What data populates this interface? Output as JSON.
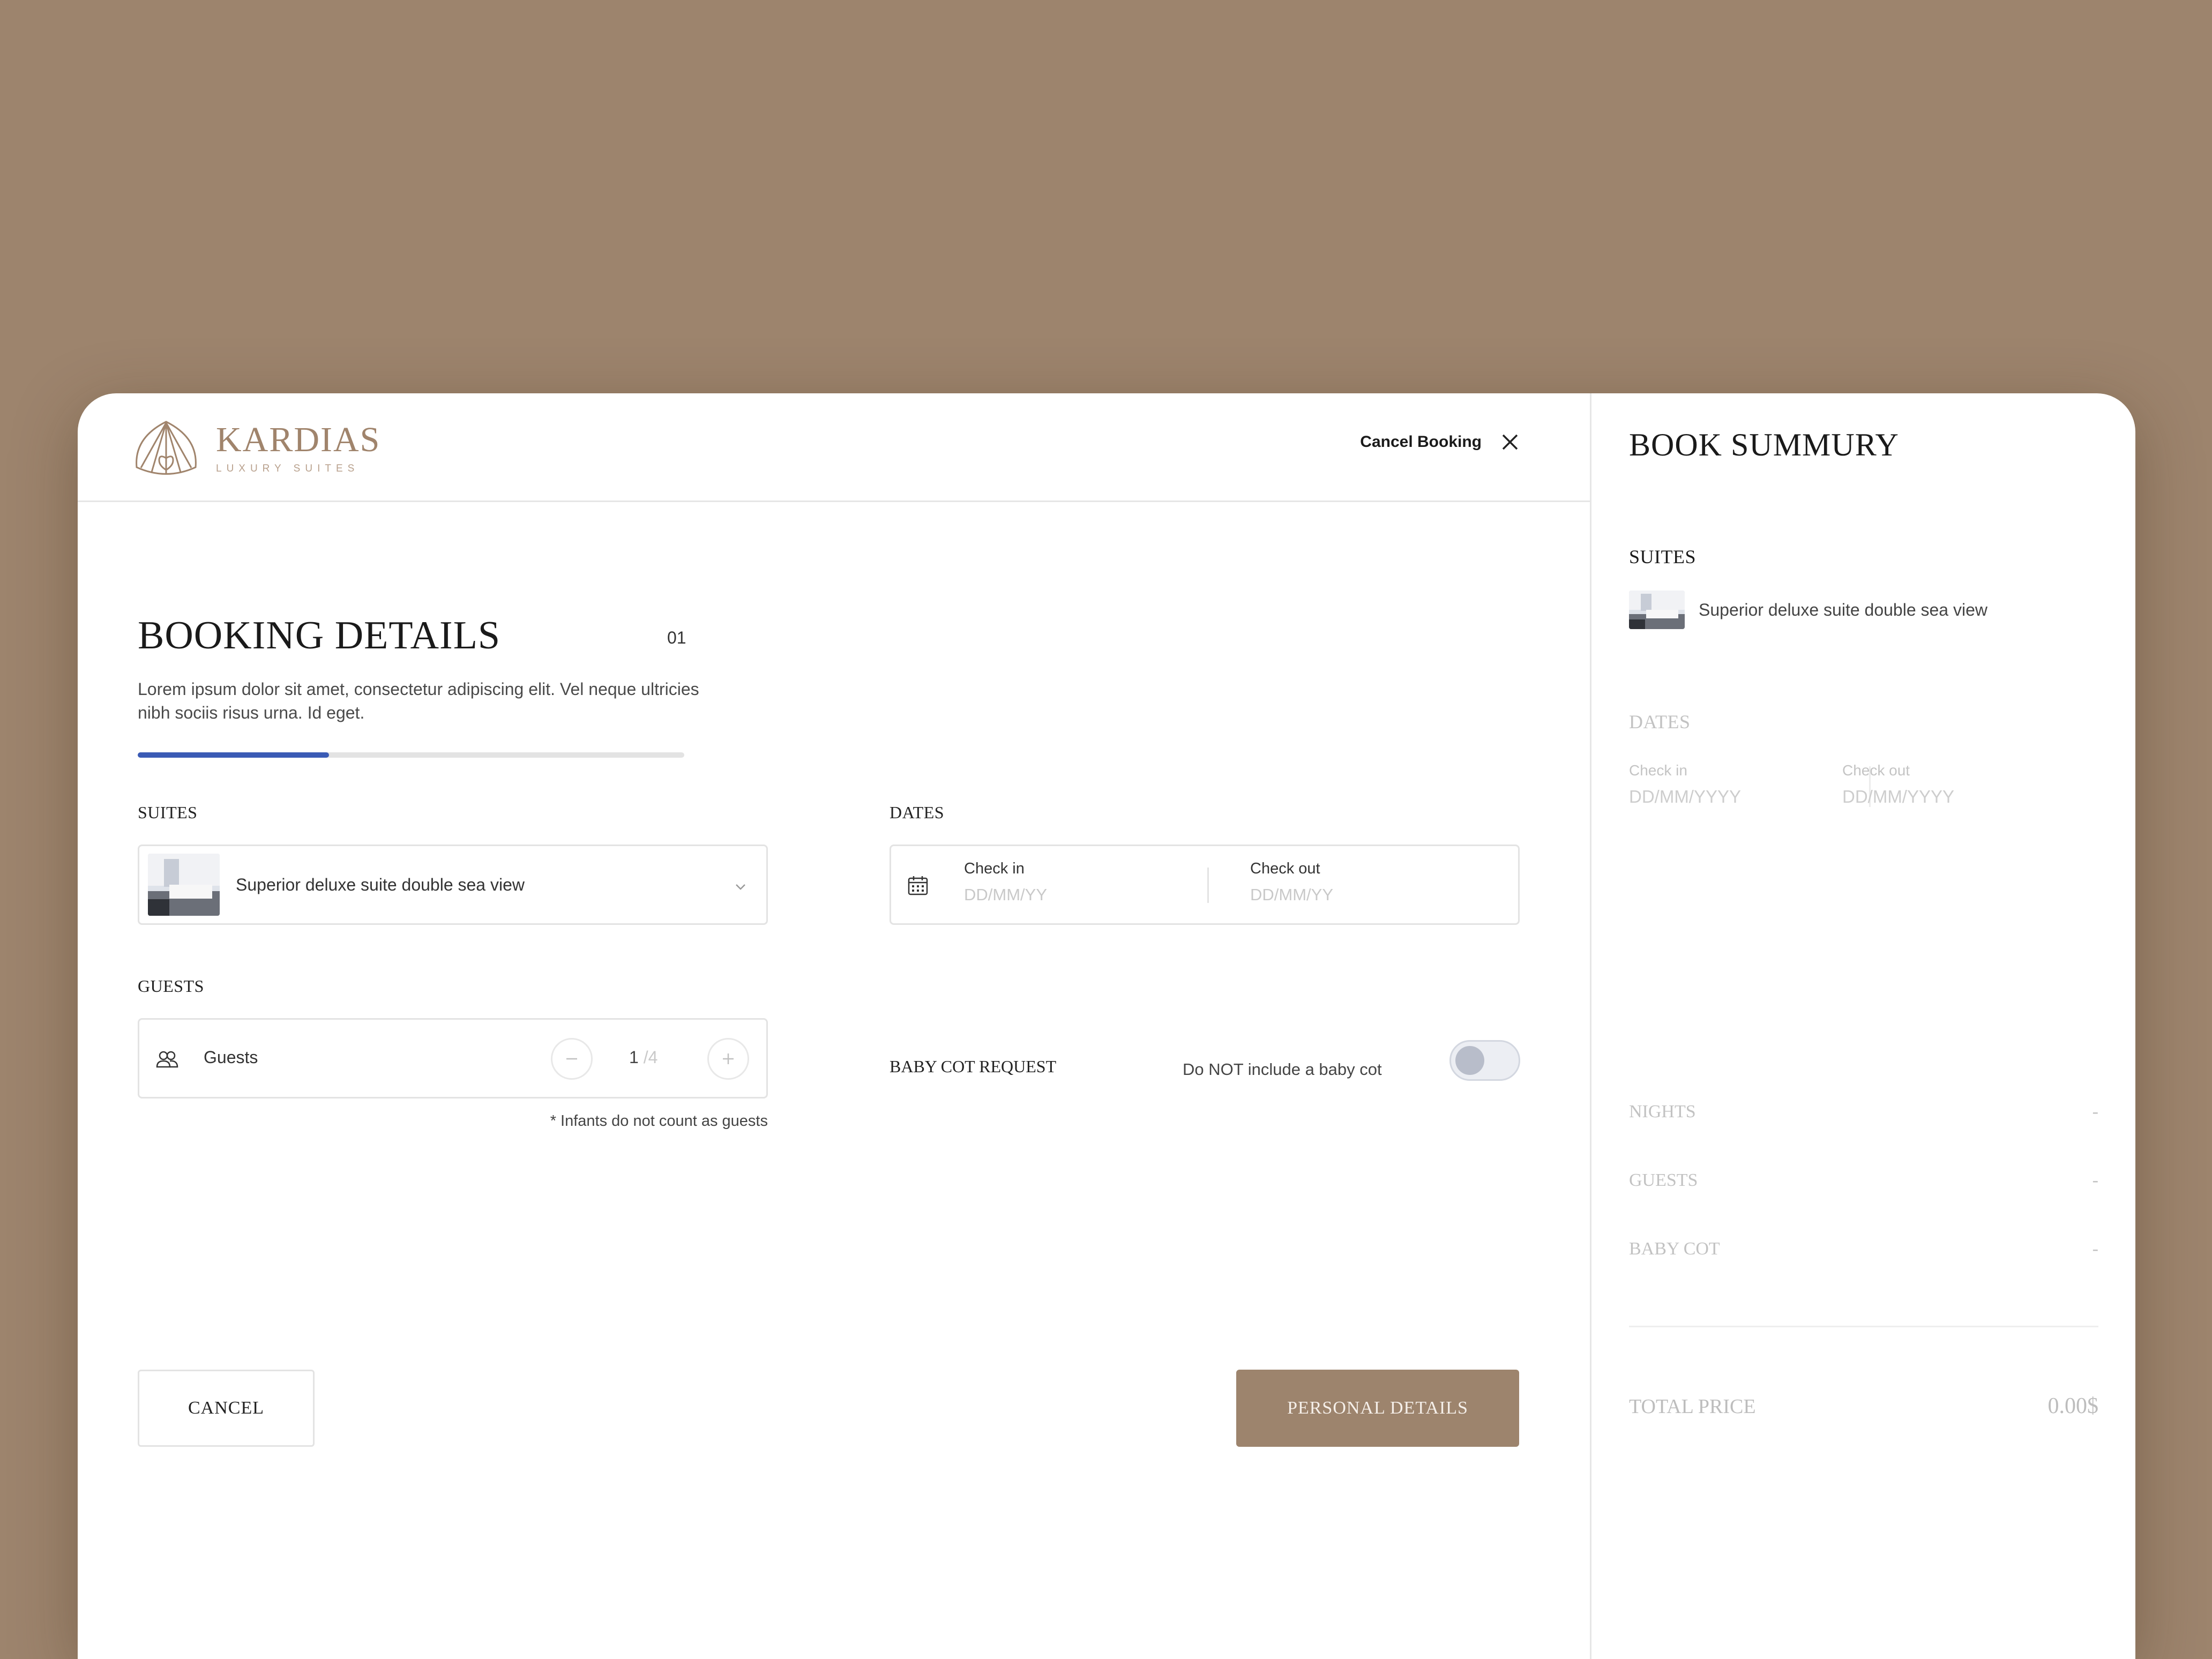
{
  "brand": {
    "name": "KARDIAS",
    "tagline": "LUXURY SUITES",
    "color": "#9d846d"
  },
  "header": {
    "cancel_booking": "Cancel Booking"
  },
  "booking": {
    "title": "BOOKING DETAILS",
    "step": "01",
    "description": "Lorem ipsum dolor sit amet, consectetur adipiscing elit. Vel neque ultricies nibh sociis risus urna. Id eget.",
    "progress_fraction": 0.35
  },
  "suites": {
    "label": "SUITES",
    "selected": "Superior deluxe suite double sea view"
  },
  "dates": {
    "label": "DATES",
    "check_in_label": "Check in",
    "check_in_placeholder": "DD/MM/YY",
    "check_out_label": "Check out",
    "check_out_placeholder": "DD/MM/YY"
  },
  "guests": {
    "label": "GUESTS",
    "field_label": "Guests",
    "value": "1",
    "max": "/4",
    "note": "* Infants do not count as guests"
  },
  "baby_cot": {
    "label": "BABY COT REQUEST",
    "text": "Do NOT include a baby cot",
    "enabled": false
  },
  "actions": {
    "cancel": "CANCEL",
    "next": "PERSONAL DETAILS"
  },
  "summary": {
    "title": "BOOK SUMMURY",
    "suites_label": "SUITES",
    "suite_name": "Superior deluxe suite double sea view",
    "dates_label": "DATES",
    "check_in_label": "Check in",
    "check_in_value": "DD/MM/YYYY",
    "check_out_label": "Check out",
    "check_out_value": "DD/MM/YYYY",
    "rows": [
      {
        "label": "NIGHTS",
        "value": "-"
      },
      {
        "label": "GUESTS",
        "value": "-"
      },
      {
        "label": "BABY COT",
        "value": "-"
      }
    ],
    "total_label": "TOTAL PRICE",
    "total_value": "0.00$"
  }
}
